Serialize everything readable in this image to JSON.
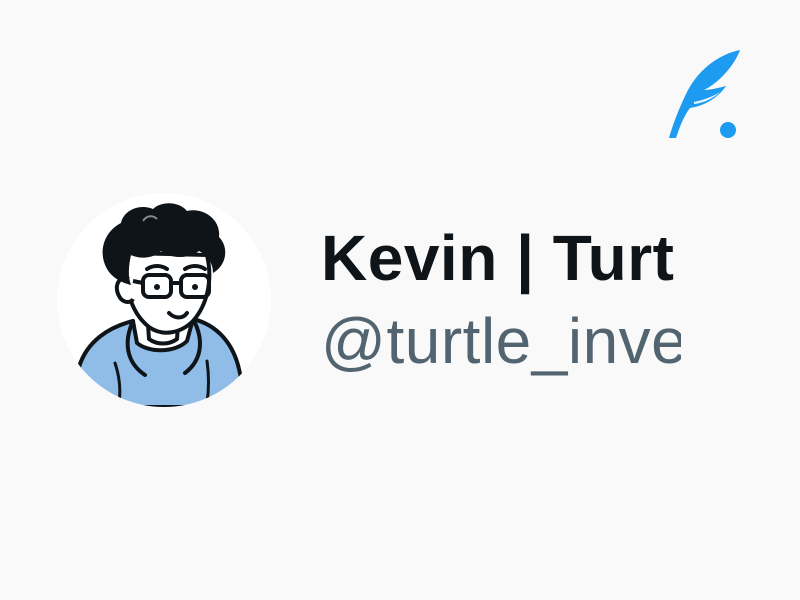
{
  "profile": {
    "display_name": "Kevin | Turt",
    "handle": "@turtle_inve",
    "avatar_icon": "cartoon-person-with-glasses-avatar"
  },
  "brand": {
    "icon": "quill-feather-logo-icon",
    "color": "#1d9bf0"
  },
  "colors": {
    "background": "#f9f9f9",
    "name_text": "#0f1419",
    "handle_text": "#536471",
    "hoodie": "#8fbde8"
  }
}
